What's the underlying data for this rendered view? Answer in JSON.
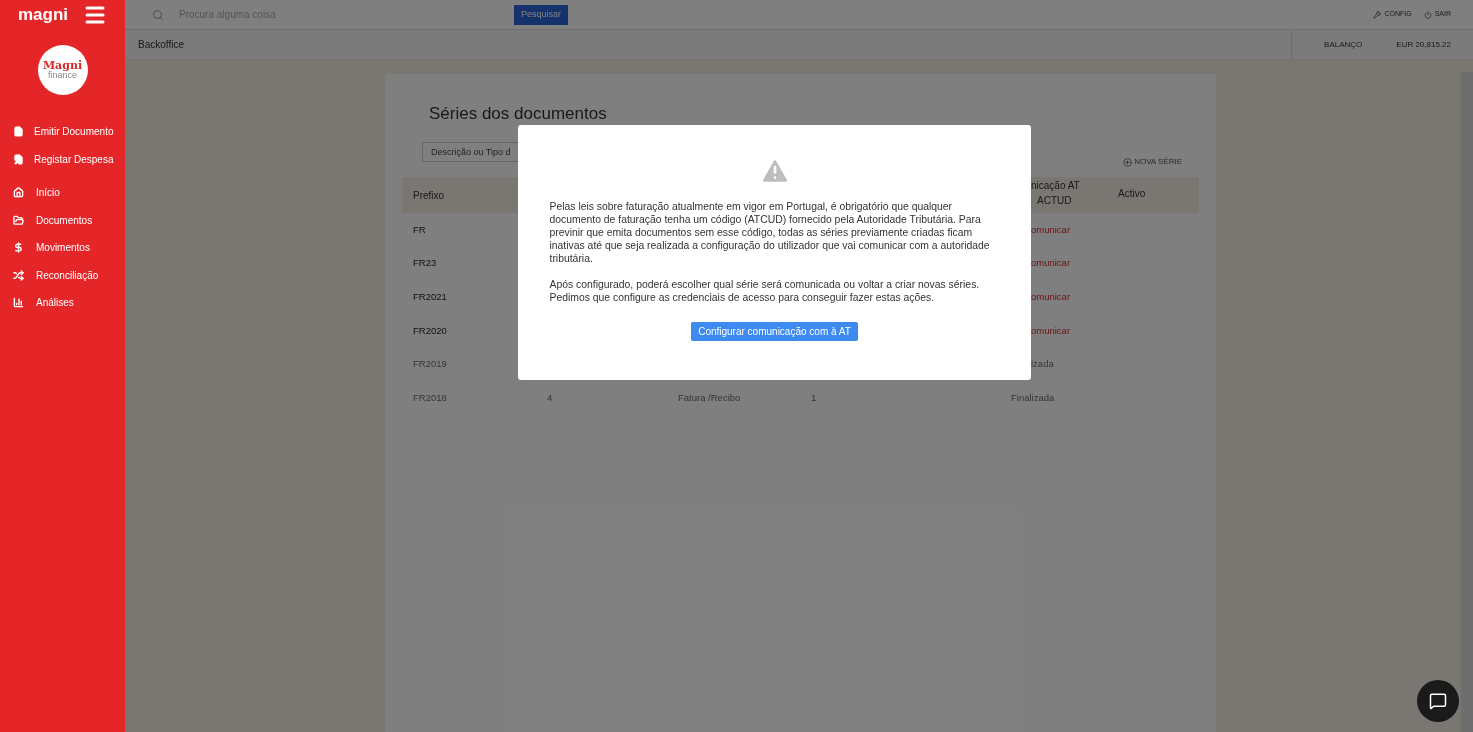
{
  "sidebar": {
    "brand": "magni",
    "logo_title": "Magni",
    "logo_subtitle": "finance",
    "actions": [
      {
        "label": "Emitir Documento"
      },
      {
        "label": "Registar Despesa"
      }
    ],
    "items": [
      {
        "label": "Início"
      },
      {
        "label": "Documentos"
      },
      {
        "label": "Movimentos"
      },
      {
        "label": "Reconciliação"
      },
      {
        "label": "Análises"
      }
    ]
  },
  "topbar": {
    "search_placeholder": "Procura alguma coisa",
    "search_button": "Pesquisar",
    "config": "CONFIG",
    "logout": "SAIR"
  },
  "breadcrumb": "Backoffice",
  "balance": {
    "label": "BALANÇO",
    "value": "EUR 20,815.22"
  },
  "page": {
    "title": "Séries dos documentos",
    "filter_placeholder": "Descrição ou Tipo d",
    "new_button": "NOVA SÉRIE",
    "columns": {
      "prefix": "Prefixo",
      "status": [
        "nicação AT",
        "ACTUD"
      ],
      "active": "Activo"
    },
    "rows": [
      {
        "prefix": "FR",
        "status": "omunicar",
        "kind": "alert",
        "disabled": false
      },
      {
        "prefix": "FR23",
        "status": "omunicar",
        "kind": "alert",
        "disabled": false
      },
      {
        "prefix": "FR2021",
        "status": "omunicar",
        "kind": "alert",
        "disabled": false
      },
      {
        "prefix": "FR2020",
        "status": "omunicar",
        "kind": "alert",
        "disabled": false
      },
      {
        "prefix": "FR2019",
        "status": "izada",
        "kind": "done",
        "disabled": true
      },
      {
        "prefix": "FR2018",
        "column_2": "4",
        "column_3": "Fatura /Recibo",
        "column_4": "1",
        "status": "Finalizada",
        "kind": "done",
        "disabled": true
      }
    ]
  },
  "dialog": {
    "paragraphs": [
      "Pelas leis sobre faturação atualmente em vigor em Portugal, é obrigatório que qualquer documento de faturação tenha um código (ATCUD) fornecido pela Autoridade Tributária. Para previnir que emita documentos sem esse código, todas as séries previamente criadas ficam inativas até que seja realizada a configuração do utilizador que vai comunicar com a autoridade tributária.",
      "Após configurado, poderá escolher qual série será comunicada ou voltar a criar novas séries. Pedimos que configure as credenciais de acesso para conseguir fazer estas ações."
    ],
    "button": "Configurar comunicação com à AT"
  }
}
